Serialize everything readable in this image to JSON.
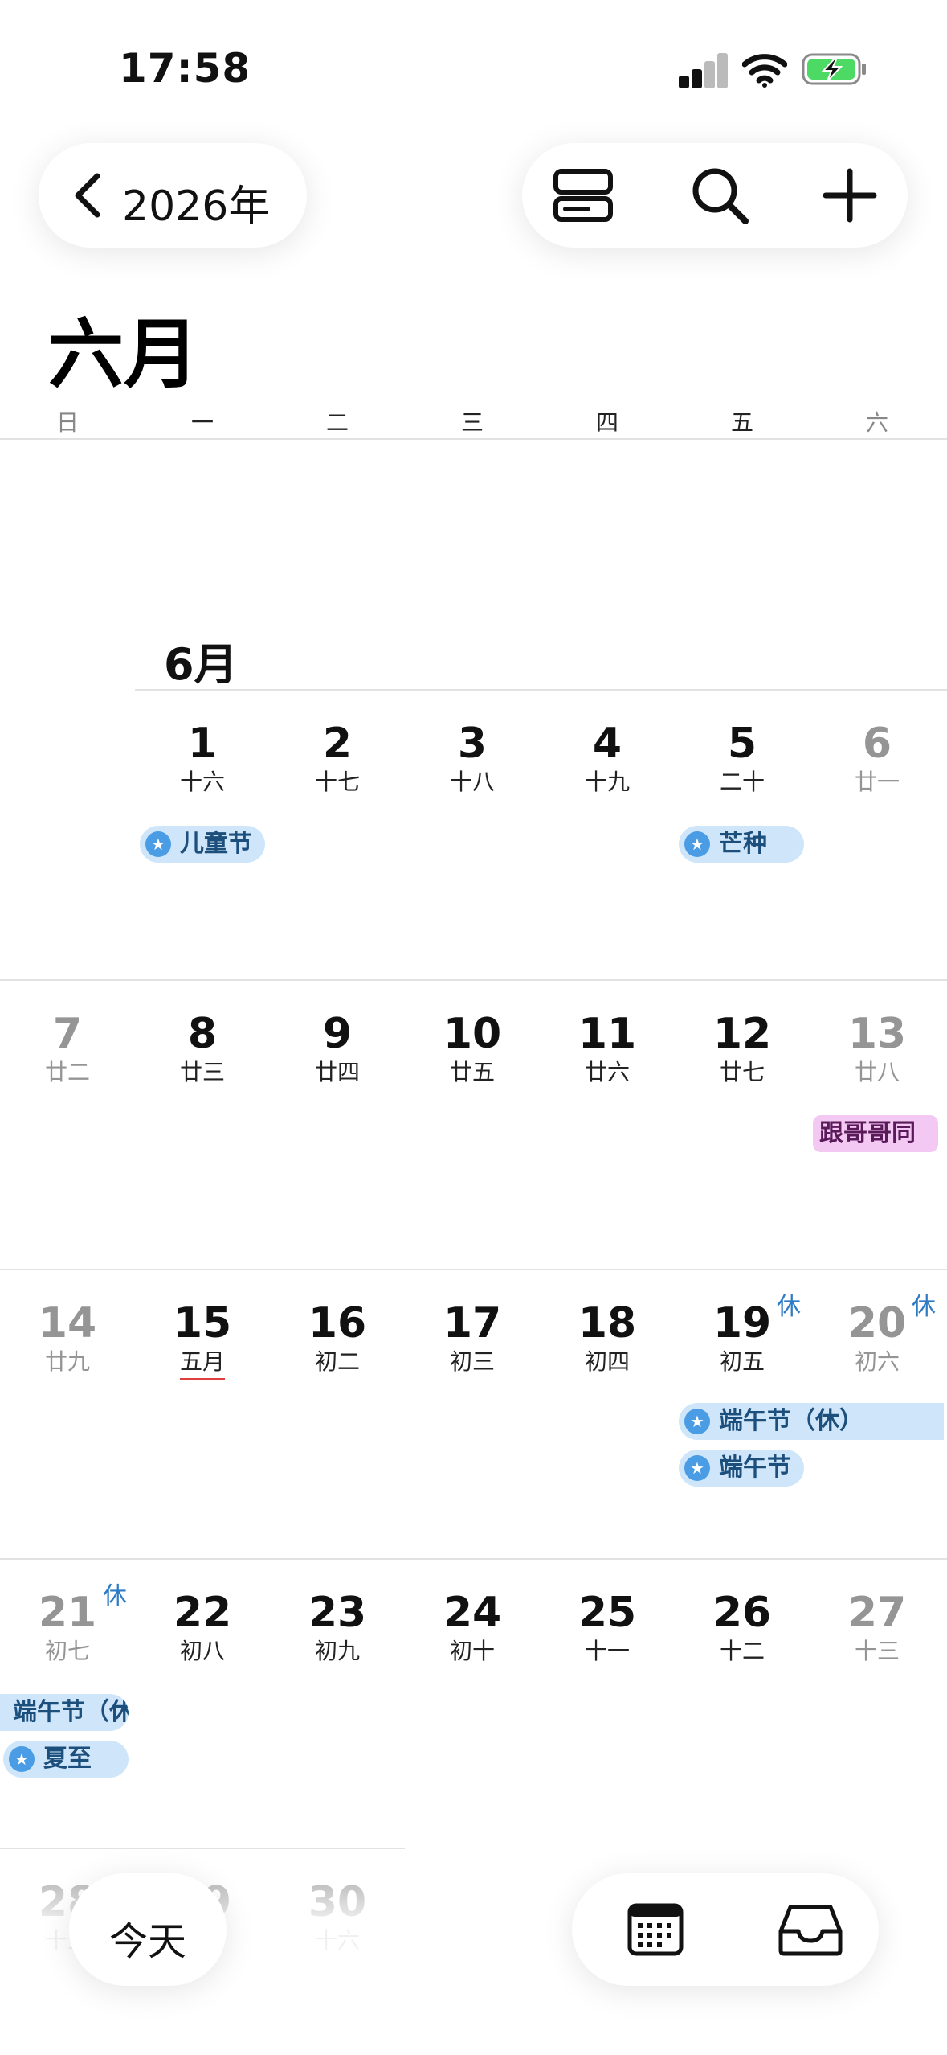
{
  "status_bar": {
    "time": "17:58"
  },
  "header": {
    "year_label": "2026年",
    "month_title": "六月",
    "month_subtitle": "6月"
  },
  "weekdays": [
    "日",
    "一",
    "二",
    "三",
    "四",
    "五",
    "六"
  ],
  "days": {
    "1": {
      "num": "1",
      "lunar": "十六"
    },
    "2": {
      "num": "2",
      "lunar": "十七"
    },
    "3": {
      "num": "3",
      "lunar": "十八"
    },
    "4": {
      "num": "4",
      "lunar": "十九"
    },
    "5": {
      "num": "5",
      "lunar": "二十"
    },
    "6": {
      "num": "6",
      "lunar": "廿一"
    },
    "7": {
      "num": "7",
      "lunar": "廿二"
    },
    "8": {
      "num": "8",
      "lunar": "廿三"
    },
    "9": {
      "num": "9",
      "lunar": "廿四"
    },
    "10": {
      "num": "10",
      "lunar": "廿五"
    },
    "11": {
      "num": "11",
      "lunar": "廿六"
    },
    "12": {
      "num": "12",
      "lunar": "廿七"
    },
    "13": {
      "num": "13",
      "lunar": "廿八"
    },
    "14": {
      "num": "14",
      "lunar": "廿九"
    },
    "15": {
      "num": "15",
      "lunar": "五月"
    },
    "16": {
      "num": "16",
      "lunar": "初二"
    },
    "17": {
      "num": "17",
      "lunar": "初三"
    },
    "18": {
      "num": "18",
      "lunar": "初四"
    },
    "19": {
      "num": "19",
      "lunar": "初五"
    },
    "20": {
      "num": "20",
      "lunar": "初六"
    },
    "21": {
      "num": "21",
      "lunar": "初七"
    },
    "22": {
      "num": "22",
      "lunar": "初八"
    },
    "23": {
      "num": "23",
      "lunar": "初九"
    },
    "24": {
      "num": "24",
      "lunar": "初十"
    },
    "25": {
      "num": "25",
      "lunar": "十一"
    },
    "26": {
      "num": "26",
      "lunar": "十二"
    },
    "27": {
      "num": "27",
      "lunar": "十三"
    },
    "28": {
      "num": "28",
      "lunar": "十五"
    },
    "29": {
      "num": "29",
      "lunar": ""
    },
    "30": {
      "num": "30",
      "lunar": "十六"
    }
  },
  "rest_badge": "休",
  "events": {
    "childrens_day": "儿童节",
    "grain_in_ear": "芒种",
    "with_brother": "跟哥哥同",
    "dragon_boat_rest": "端午节（休）",
    "dragon_boat": "端午节",
    "dragon_boat_rest_cont": "端午节（休",
    "summer_solstice": "夏至"
  },
  "event_icon": "star-icon",
  "bottom_bar": {
    "today_label": "今天"
  },
  "colors": {
    "event_bg": "#cfe6fa",
    "event_text": "#1d4f7d",
    "event_star": "#4a9ce4",
    "personal_event_bg": "#f3c9f3",
    "today_underline": "#e03e3e",
    "rest_badge": "#2e7ac4",
    "battery_charging": "#4cd964"
  }
}
